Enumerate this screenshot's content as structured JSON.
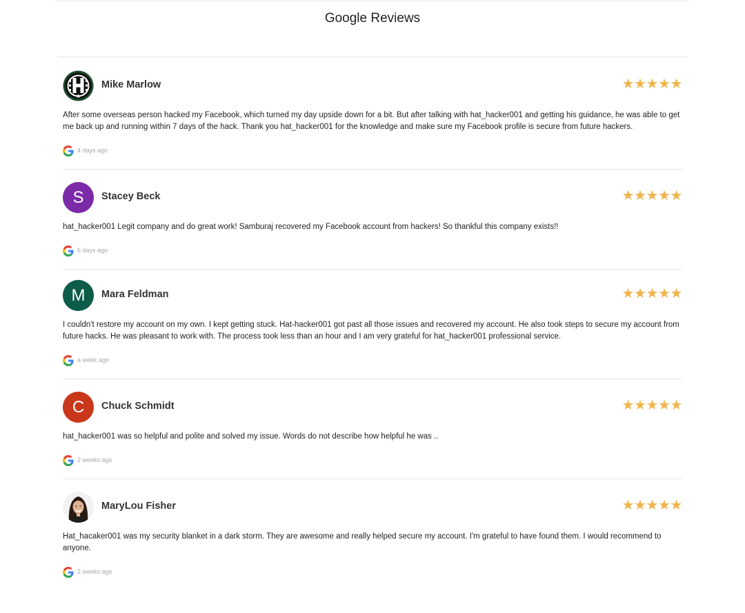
{
  "page": {
    "title": "Google Reviews"
  },
  "colors": {
    "star": "#f0b44c",
    "avatar_stacey": "#7b2aa8",
    "avatar_mara": "#0d5c4a",
    "avatar_chuck": "#c9371a"
  },
  "reviews": [
    {
      "name": "Mike Marlow",
      "avatar_letter": "",
      "avatar_icon": "hat-hacker-logo-icon",
      "rating": 5,
      "text": "After some overseas person hacked my Facebook, which turned my day upside down for a bit. But after talking with hat_hacker001 and getting his guidance, he was able to get me back up and running within 7 days of the hack. Thank you hat_hacker001 for the knowledge and make sure my Facebook profile is secure from future hackers.",
      "time": "4 days ago"
    },
    {
      "name": "Stacey Beck",
      "avatar_letter": "S",
      "rating": 5,
      "text": "hat_hacker001 Legit company and do great work! Samburaj recovered my Facebook account from hackers! So thankful this company exists!!",
      "time": "6 days ago"
    },
    {
      "name": "Mara Feldman",
      "avatar_letter": "M",
      "rating": 5,
      "text": "I couldn't restore my account on my own. I kept getting stuck. Hat-hacker001 got past all those issues and recovered my account. He also took steps to secure my account from future hacks. He was pleasant to work with. The process took less than an hour and I am very grateful for hat_hacker001 professional service.",
      "time": "a week ago"
    },
    {
      "name": "Chuck Schmidt",
      "avatar_letter": "C",
      "rating": 5,
      "text": "hat_hacker001 was so helpful and polite and solved my issue. Words do not describe how helpful he was ..",
      "time": "2 weeks ago"
    },
    {
      "name": "MaryLou Fisher",
      "avatar_letter": "",
      "avatar_icon": "user-photo-icon",
      "rating": 5,
      "text": "Hat_hacaker001 was my security blanket in a dark storm. They are awesome and really helped secure my account. I'm grateful to have found them. I would recommend to anyone.",
      "time": "2 weeks ago"
    }
  ]
}
